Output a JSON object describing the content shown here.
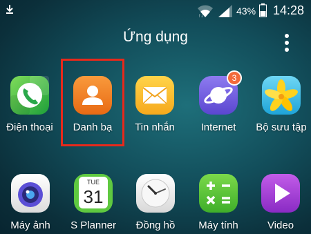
{
  "status_bar": {
    "battery": "43%",
    "time": "14:28"
  },
  "title": "Ứng dụng",
  "calendar": {
    "day": "TUE",
    "date": "31"
  },
  "apps_row1": [
    {
      "label": "Điện thoại",
      "icon": "phone-icon"
    },
    {
      "label": "Danh bạ",
      "icon": "contacts-icon"
    },
    {
      "label": "Tin nhắn",
      "icon": "messages-icon"
    },
    {
      "label": "Internet",
      "icon": "internet-icon",
      "badge": "3"
    },
    {
      "label": "Bộ sưu tập",
      "icon": "gallery-icon"
    }
  ],
  "apps_row2": [
    {
      "label": "Máy ảnh",
      "icon": "camera-icon"
    },
    {
      "label": "S Planner",
      "icon": "calendar-icon"
    },
    {
      "label": "Đồng hồ",
      "icon": "clock-icon"
    },
    {
      "label": "Máy tính",
      "icon": "calculator-icon"
    },
    {
      "label": "Video",
      "icon": "video-icon"
    }
  ],
  "colors": {
    "highlight": "#e8291b",
    "badge": "#f26a3b"
  }
}
